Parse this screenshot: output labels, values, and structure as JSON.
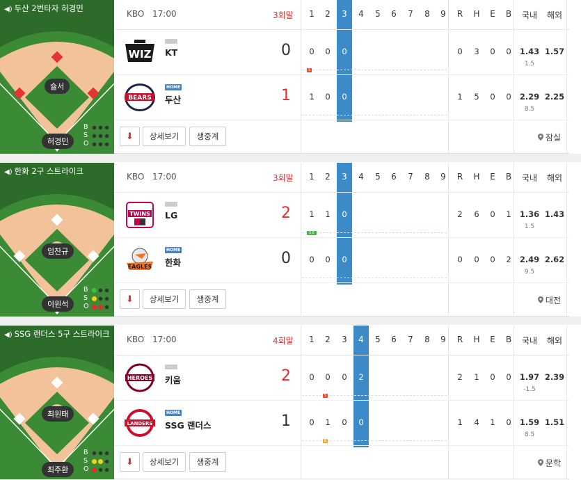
{
  "header": {
    "innings": [
      "1",
      "2",
      "3",
      "4",
      "5",
      "6",
      "7",
      "8",
      "9"
    ],
    "stats": [
      "R",
      "H",
      "E",
      "B"
    ],
    "odds": [
      "국내",
      "해외"
    ]
  },
  "games": [
    {
      "status": "두산 2번타자 허경민",
      "league": "KBO",
      "time": "17:00",
      "inning": "3회말",
      "current_inning": 3,
      "pitcher": "슐서",
      "batter": "허경민",
      "bso": {
        "B": 0,
        "S": 0,
        "O": 0
      },
      "bso_labels": [
        "B",
        "S",
        "O"
      ],
      "runners": {
        "first": true,
        "second": true,
        "third": true
      },
      "teams": [
        {
          "name": "KT",
          "logo": "WIZ",
          "home": false,
          "score": "0",
          "innings": [
            "0",
            "0",
            "0"
          ],
          "R": "0",
          "H": "3",
          "E": "0",
          "B": "0",
          "odd1": "1.43",
          "odd1_sub": "1.5",
          "odd2": "1.57",
          "chip": "S",
          "chip_color": "r"
        },
        {
          "name": "두산",
          "logo": "BEARS",
          "home": true,
          "home_badge": "HOME",
          "score": "1",
          "innings": [
            "1",
            "0",
            "0"
          ],
          "R": "1",
          "H": "5",
          "E": "0",
          "B": "0",
          "odd1": "2.29",
          "odd1_sub": "8.5",
          "odd2": "2.25"
        }
      ],
      "buttons": {
        "arrow": "⬇",
        "detail": "상세보기",
        "live": "생중계"
      },
      "stadium": "잠실"
    },
    {
      "status": "한화 2구 스트라이크",
      "league": "KBO",
      "time": "17:00",
      "inning": "3회말",
      "current_inning": 3,
      "pitcher": "임찬규",
      "batter": "이원석",
      "bso": {
        "B": 1,
        "S": 1,
        "O": 2
      },
      "bso_labels": [
        "B",
        "S",
        "O"
      ],
      "runners": {
        "first": false,
        "second": false,
        "third": false
      },
      "teams": [
        {
          "name": "LG",
          "logo": "TWINS",
          "home": false,
          "score": "2",
          "innings": [
            "1",
            "1",
            "0"
          ],
          "R": "2",
          "H": "6",
          "E": "0",
          "B": "1",
          "odd1": "1.36",
          "odd1_sub": "1.5",
          "odd2": "1.43",
          "chip": "S E",
          "chip_color": "g"
        },
        {
          "name": "한화",
          "logo": "EAGLES",
          "home": true,
          "home_badge": "HOME",
          "score": "0",
          "innings": [
            "0",
            "0",
            "0"
          ],
          "R": "0",
          "H": "0",
          "E": "0",
          "B": "2",
          "odd1": "2.49",
          "odd1_sub": "9.5",
          "odd2": "2.62"
        }
      ],
      "buttons": {
        "arrow": "⬇",
        "detail": "상세보기",
        "live": "생중계"
      },
      "stadium": "대전"
    },
    {
      "status": "SSG 랜더스 5구 스트라이크",
      "league": "KBO",
      "time": "17:00",
      "inning": "4회말",
      "current_inning": 4,
      "pitcher": "최원태",
      "batter": "최주환",
      "bso": {
        "B": 0,
        "S": 2,
        "O": 1
      },
      "bso_labels": [
        "B",
        "S",
        "O"
      ],
      "runners": {
        "first": false,
        "second": false,
        "third": false
      },
      "teams": [
        {
          "name": "키움",
          "logo": "HEROES",
          "home": false,
          "score": "2",
          "innings": [
            "0",
            "0",
            "0",
            "2"
          ],
          "R": "2",
          "H": "1",
          "E": "0",
          "B": "0",
          "odd1": "1.97",
          "odd1_sub": "-1.5",
          "odd2": "2.39",
          "chip": "S",
          "chip_color": "r",
          "chip_inning": 2
        },
        {
          "name": "SSG 랜더스",
          "logo": "LANDERS",
          "home": true,
          "home_badge": "HOME",
          "score": "1",
          "innings": [
            "0",
            "1",
            "0",
            "0"
          ],
          "R": "1",
          "H": "4",
          "E": "1",
          "B": "0",
          "odd1": "1.59",
          "odd1_sub": "8.5",
          "odd2": "1.51",
          "chip": "B",
          "chip_color": "o",
          "chip_inning": 2
        }
      ],
      "buttons": {
        "arrow": "⬇",
        "detail": "상세보기",
        "live": "생중계"
      },
      "stadium": "문학"
    }
  ],
  "colors": {
    "grass": "#3b8a35",
    "dark_grass": "#2e6f2a",
    "dirt": "#f2c39a",
    "highlight": "#3d8ac9",
    "score_red": "#e03030"
  }
}
